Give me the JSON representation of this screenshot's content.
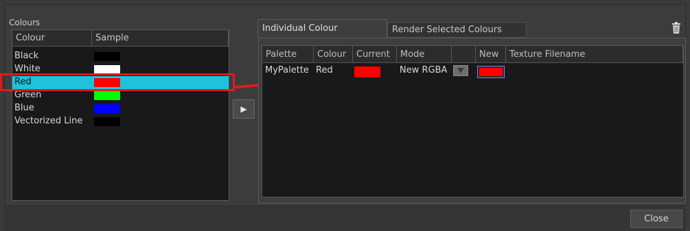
{
  "colours_panel": {
    "title": "Colours",
    "headers": {
      "colour": "Colour",
      "sample": "Sample"
    },
    "rows": [
      {
        "name": "Black",
        "color": "#000000"
      },
      {
        "name": "White",
        "color": "#ffffff"
      },
      {
        "name": "Red",
        "color": "#ff0000"
      },
      {
        "name": "Green",
        "color": "#00ff00"
      },
      {
        "name": "Blue",
        "color": "#0000ff"
      },
      {
        "name": "Vectorized Line",
        "color": "#000000"
      }
    ],
    "selected": "Red",
    "selection_color": "#1ec2dc"
  },
  "transfer_button": {
    "icon": "play-right-icon",
    "glyph": "▶"
  },
  "tabs": [
    {
      "label": "Individual Colour Overrides",
      "active": true
    },
    {
      "label": "Render Selected Colours Only",
      "active": false
    }
  ],
  "delete_icon": "trash-icon",
  "overrides": {
    "headers": {
      "palette": "Palette",
      "colour": "Colour",
      "current": "Current",
      "mode": "Mode",
      "blank": "",
      "new": "New",
      "texture": "Texture Filename"
    },
    "row": {
      "palette": "MyPalette",
      "colour": "Red",
      "current_color": "#ff0000",
      "mode": "New RGBA",
      "new_color": "#ff0000",
      "texture": ""
    }
  },
  "annotation_color": "#e01b1b",
  "footer": {
    "close_label": "Close"
  }
}
